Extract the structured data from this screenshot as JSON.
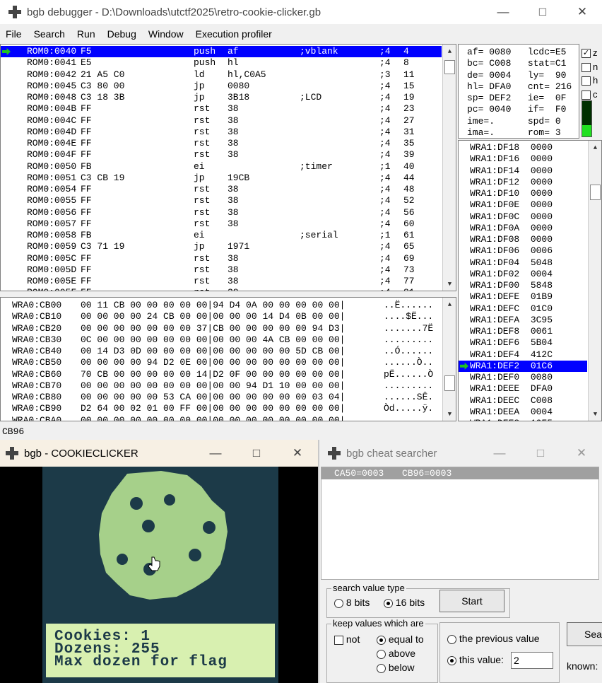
{
  "debugger": {
    "title": "bgb debugger - D:\\Downloads\\utctf2025\\retro-cookie-clicker.gb",
    "menu": [
      "File",
      "Search",
      "Run",
      "Debug",
      "Window",
      "Execution profiler"
    ],
    "disasm": [
      {
        "addr": "ROM0:0040",
        "bytes": "F5",
        "op": "push",
        "args": "af",
        "comment": ";vblank",
        "cyc": ";4",
        "total": "4"
      },
      {
        "addr": "ROM0:0041",
        "bytes": "E5",
        "op": "push",
        "args": "hl",
        "comment": "",
        "cyc": ";4",
        "total": "8"
      },
      {
        "addr": "ROM0:0042",
        "bytes": "21 A5 C0",
        "op": "ld",
        "args": "hl,C0A5",
        "comment": "",
        "cyc": ";3",
        "total": "11"
      },
      {
        "addr": "ROM0:0045",
        "bytes": "C3 80 00",
        "op": "jp",
        "args": "0080",
        "comment": "",
        "cyc": ";4",
        "total": "15"
      },
      {
        "addr": "ROM0:0048",
        "bytes": "C3 18 3B",
        "op": "jp",
        "args": "3B18",
        "comment": ";LCD",
        "cyc": ";4",
        "total": "19"
      },
      {
        "addr": "ROM0:004B",
        "bytes": "FF",
        "op": "rst",
        "args": "38",
        "comment": "",
        "cyc": ";4",
        "total": "23"
      },
      {
        "addr": "ROM0:004C",
        "bytes": "FF",
        "op": "rst",
        "args": "38",
        "comment": "",
        "cyc": ";4",
        "total": "27"
      },
      {
        "addr": "ROM0:004D",
        "bytes": "FF",
        "op": "rst",
        "args": "38",
        "comment": "",
        "cyc": ";4",
        "total": "31"
      },
      {
        "addr": "ROM0:004E",
        "bytes": "FF",
        "op": "rst",
        "args": "38",
        "comment": "",
        "cyc": ";4",
        "total": "35"
      },
      {
        "addr": "ROM0:004F",
        "bytes": "FF",
        "op": "rst",
        "args": "38",
        "comment": "",
        "cyc": ";4",
        "total": "39"
      },
      {
        "addr": "ROM0:0050",
        "bytes": "FB",
        "op": "ei",
        "args": "",
        "comment": ";timer",
        "cyc": ";1",
        "total": "40"
      },
      {
        "addr": "ROM0:0051",
        "bytes": "C3 CB 19",
        "op": "jp",
        "args": "19CB",
        "comment": "",
        "cyc": ";4",
        "total": "44"
      },
      {
        "addr": "ROM0:0054",
        "bytes": "FF",
        "op": "rst",
        "args": "38",
        "comment": "",
        "cyc": ";4",
        "total": "48"
      },
      {
        "addr": "ROM0:0055",
        "bytes": "FF",
        "op": "rst",
        "args": "38",
        "comment": "",
        "cyc": ";4",
        "total": "52"
      },
      {
        "addr": "ROM0:0056",
        "bytes": "FF",
        "op": "rst",
        "args": "38",
        "comment": "",
        "cyc": ";4",
        "total": "56"
      },
      {
        "addr": "ROM0:0057",
        "bytes": "FF",
        "op": "rst",
        "args": "38",
        "comment": "",
        "cyc": ";4",
        "total": "60"
      },
      {
        "addr": "ROM0:0058",
        "bytes": "FB",
        "op": "ei",
        "args": "",
        "comment": ";serial",
        "cyc": ";1",
        "total": "61"
      },
      {
        "addr": "ROM0:0059",
        "bytes": "C3 71 19",
        "op": "jp",
        "args": "1971",
        "comment": "",
        "cyc": ";4",
        "total": "65"
      },
      {
        "addr": "ROM0:005C",
        "bytes": "FF",
        "op": "rst",
        "args": "38",
        "comment": "",
        "cyc": ";4",
        "total": "69"
      },
      {
        "addr": "ROM0:005D",
        "bytes": "FF",
        "op": "rst",
        "args": "38",
        "comment": "",
        "cyc": ";4",
        "total": "73"
      },
      {
        "addr": "ROM0:005E",
        "bytes": "FF",
        "op": "rst",
        "args": "38",
        "comment": "",
        "cyc": ";4",
        "total": "77"
      },
      {
        "addr": "ROM0:005F",
        "bytes": "FF",
        "op": "rst",
        "args": "38",
        "comment": "",
        "cyc": ";4",
        "total": "81"
      }
    ],
    "registers": [
      "af= 0080   lcdc=E5",
      "bc= C008   stat=C1",
      "de= 0004   ly=  90",
      "hl= DFA0   cnt= 216",
      "sp= DEF2   ie=  0F",
      "pc= 0040   if=  F0",
      "ime=.      spd= 0",
      "ima=.      rom= 3"
    ],
    "flags": [
      "z",
      "n",
      "h",
      "c"
    ],
    "stack": [
      "WRA1:DF18  0000",
      "WRA1:DF16  0000",
      "WRA1:DF14  0000",
      "WRA1:DF12  0000",
      "WRA1:DF10  0000",
      "WRA1:DF0E  0000",
      "WRA1:DF0C  0000",
      "WRA1:DF0A  0000",
      "WRA1:DF08  0000",
      "WRA1:DF06  0006",
      "WRA1:DF04  5048",
      "WRA1:DF02  0004",
      "WRA1:DF00  5848",
      "WRA1:DEFE  01B9",
      "WRA1:DEFC  01C0",
      "WRA1:DEFA  3C95",
      "WRA1:DEF8  0061",
      "WRA1:DEF6  5B04",
      "WRA1:DEF4  412C",
      "WRA1:DEF2  01C6",
      "WRA1:DEF0  0080",
      "WRA1:DEEE  DFA0",
      "WRA1:DEEC  C008",
      "WRA1:DEEA  0004",
      "WRA1:DEE8  10F5"
    ],
    "memory": [
      {
        "addr": "WRA0:CB00",
        "hex": "00 11 CB 00 00 00 00 00|94 D4 0A 00 00 00 00 00|",
        "ascii": "..Ë......"
      },
      {
        "addr": "WRA0:CB10",
        "hex": "00 00 00 00 24 CB 00 00|00 00 00 14 D4 0B 00 00|",
        "ascii": "....$Ë..."
      },
      {
        "addr": "WRA0:CB20",
        "hex": "00 00 00 00 00 00 00 37|CB 00 00 00 00 00 94 D3|",
        "ascii": ".......7Ë"
      },
      {
        "addr": "WRA0:CB30",
        "hex": "0C 00 00 00 00 00 00 00|00 00 00 4A CB 00 00 00|",
        "ascii": "........."
      },
      {
        "addr": "WRA0:CB40",
        "hex": "00 14 D3 0D 00 00 00 00|00 00 00 00 00 5D CB 00|",
        "ascii": "..Ó......"
      },
      {
        "addr": "WRA0:CB50",
        "hex": "00 00 00 00 94 D2 0E 00|00 00 00 00 00 00 00 00|",
        "ascii": "......Ò.."
      },
      {
        "addr": "WRA0:CB60",
        "hex": "70 CB 00 00 00 00 00 14|D2 0F 00 00 00 00 00 00|",
        "ascii": "pË......Ò"
      },
      {
        "addr": "WRA0:CB70",
        "hex": "00 00 00 00 00 00 00 00|00 00 94 D1 10 00 00 00|",
        "ascii": "........."
      },
      {
        "addr": "WRA0:CB80",
        "hex": "00 00 00 00 00 53 CA 00|00 00 00 00 00 00 03 04|",
        "ascii": "......SÊ."
      },
      {
        "addr": "WRA0:CB90",
        "hex": "D2 64 00 02 01 00 FF 00|00 00 00 00 00 00 00 00|",
        "ascii": "Òd.....ÿ."
      },
      {
        "addr": "WRA0:CBA0",
        "hex": "00 00 00 00 00 00 00 00|00 00 00 00 00 00 00 00|",
        "ascii": "........."
      }
    ],
    "status": "CB96"
  },
  "game": {
    "title": "bgb - COOKIECLICKER",
    "text_lines": [
      "Cookies: 1",
      "Dozens: 255",
      "Max dozen for flag"
    ]
  },
  "cheat": {
    "title": "bgb cheat searcher",
    "results": [
      "CA50=0003",
      "CB96=0003"
    ],
    "group_type_label": "search value type",
    "opt_8bits": "8 bits",
    "opt_16bits": "16 bits",
    "start_label": "Start",
    "group_keep_label": "keep values which are",
    "not_label": "not",
    "equal_label": "equal to",
    "above_label": "above",
    "below_label": "below",
    "prev_label": "the previous value",
    "this_label": "this value:",
    "this_value": "2",
    "search_label": "Sea",
    "known_label": "known:"
  },
  "colors": {
    "selection": "#0000ff",
    "gb_dark": "#1c3a48",
    "gb_light": "#a6d08a",
    "gb_panel": "#d8f0b0"
  }
}
